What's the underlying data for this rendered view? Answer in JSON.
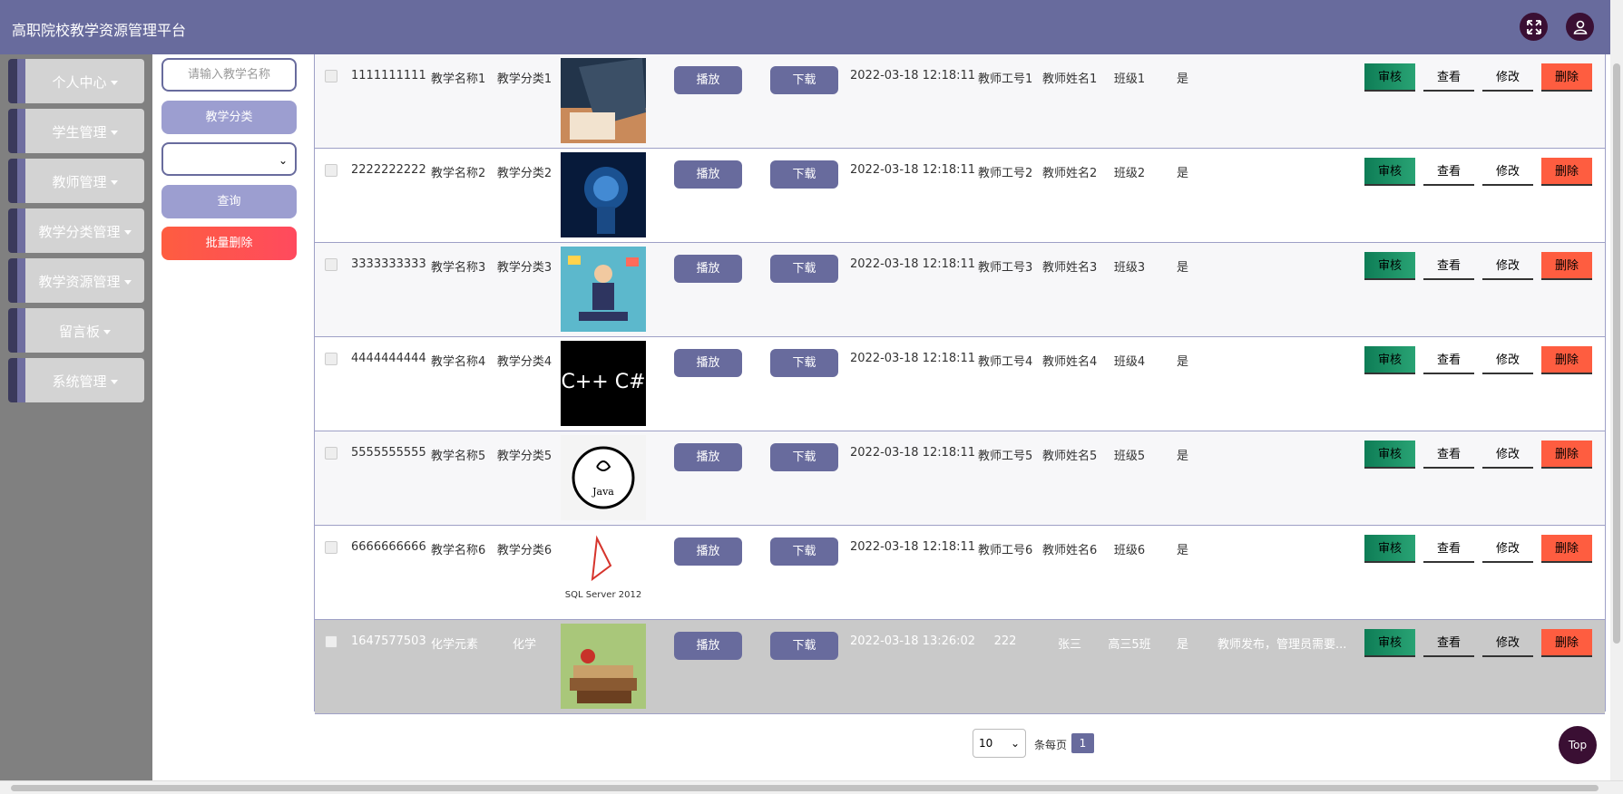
{
  "app": {
    "title": "高职院校教学资源管理平台"
  },
  "header": {
    "fullscreen_icon": "expand-icon",
    "user_icon": "user-icon"
  },
  "sidebar": {
    "items": [
      {
        "label": "个人中心"
      },
      {
        "label": "学生管理"
      },
      {
        "label": "教师管理"
      },
      {
        "label": "教学分类管理"
      },
      {
        "label": "教学资源管理"
      },
      {
        "label": "留言板"
      },
      {
        "label": "系统管理"
      }
    ]
  },
  "filter": {
    "search_placeholder": "请输入教学名称",
    "category_button": "教学分类",
    "select_value": "",
    "query_button": "查询",
    "batch_delete_button": "批量删除"
  },
  "table": {
    "play_label": "播放",
    "download_label": "下载",
    "actions": {
      "audit": "审核",
      "view": "查看",
      "edit": "修改",
      "delete": "删除"
    },
    "rows": [
      {
        "id": "1111111111",
        "name": "教学名称1",
        "category": "教学分类1",
        "image": "laptop-photo",
        "time": "2022-03-18 12:18:11",
        "teacher_no": "教师工号1",
        "teacher_name": "教师姓名1",
        "class": "班级1",
        "flag": "是",
        "note": ""
      },
      {
        "id": "2222222222",
        "name": "教学名称2",
        "category": "教学分类2",
        "image": "ai-head-photo",
        "time": "2022-03-18 12:18:11",
        "teacher_no": "教师工号2",
        "teacher_name": "教师姓名2",
        "class": "班级2",
        "flag": "是",
        "note": ""
      },
      {
        "id": "3333333333",
        "name": "教学名称3",
        "category": "教学分类3",
        "image": "multitask-illustration",
        "time": "2022-03-18 12:18:11",
        "teacher_no": "教师工号3",
        "teacher_name": "教师姓名3",
        "class": "班级3",
        "flag": "是",
        "note": ""
      },
      {
        "id": "4444444444",
        "name": "教学名称4",
        "category": "教学分类4",
        "image": "cpp-wordcloud",
        "time": "2022-03-18 12:18:11",
        "teacher_no": "教师工号4",
        "teacher_name": "教师姓名4",
        "class": "班级4",
        "flag": "是",
        "note": ""
      },
      {
        "id": "5555555555",
        "name": "教学名称5",
        "category": "教学分类5",
        "image": "java-logo",
        "time": "2022-03-18 12:18:11",
        "teacher_no": "教师工号5",
        "teacher_name": "教师姓名5",
        "class": "班级5",
        "flag": "是",
        "note": ""
      },
      {
        "id": "6666666666",
        "name": "教学名称6",
        "category": "教学分类6",
        "image": "sql-server-logo",
        "time": "2022-03-18 12:18:11",
        "teacher_no": "教师工号6",
        "teacher_name": "教师姓名6",
        "class": "班级6",
        "flag": "是",
        "note": ""
      },
      {
        "id": "1647577503",
        "name": "化学元素",
        "category": "化学",
        "image": "books-photo",
        "time": "2022-03-18 13:26:02",
        "teacher_no": "222",
        "teacher_name": "张三",
        "class": "高三5班",
        "flag": "是",
        "note": "教师发布，管理员需要..."
      }
    ]
  },
  "pagination": {
    "page_size": "10",
    "per_page_label": "条每页",
    "current_page": "1"
  },
  "top_button": "Top",
  "image_text": {
    "java_logo": "Java",
    "sql_logo": "SQL Server 2012",
    "cpp_cloud": "C++ C#"
  },
  "colors": {
    "header": "#686b9d",
    "sidebar": "#808080",
    "audit": "#0e7d56",
    "delete": "#fe5d40",
    "top": "#3a0f33"
  }
}
